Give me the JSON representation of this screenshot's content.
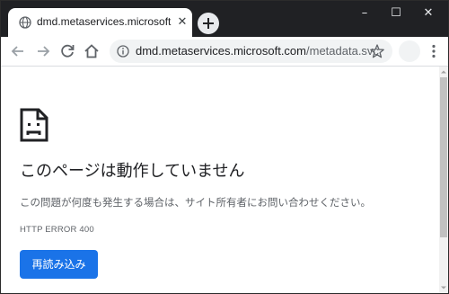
{
  "tab": {
    "title": "dmd.metaservices.microsoft.com",
    "favicon": "globe-icon",
    "close_icon": "close-icon"
  },
  "newtab_icon": "plus-icon",
  "window_controls": {
    "minimize": "–",
    "maximize": "☐",
    "close": "✕"
  },
  "toolbar": {
    "back_icon": "arrow-left-icon",
    "forward_icon": "arrow-right-icon",
    "reload_icon": "reload-icon",
    "home_icon": "home-icon",
    "menu_icon": "kebab-menu-icon"
  },
  "omnibox": {
    "host": "dmd.metaservices.microsoft.com",
    "path": "/metadata.svc",
    "info_icon": "info-icon",
    "star_icon": "star-icon"
  },
  "error_page": {
    "icon": "sad-page-icon",
    "heading": "このページは動作していません",
    "description": "この問題が何度も発生する場合は、サイト所有者にお問い合わせください。",
    "error_code": "HTTP ERROR 400",
    "reload_button": "再読み込み"
  },
  "colors": {
    "tabstrip": "#202124",
    "accent": "#1a73e8",
    "text_primary": "#202124",
    "text_secondary": "#5f6368"
  }
}
